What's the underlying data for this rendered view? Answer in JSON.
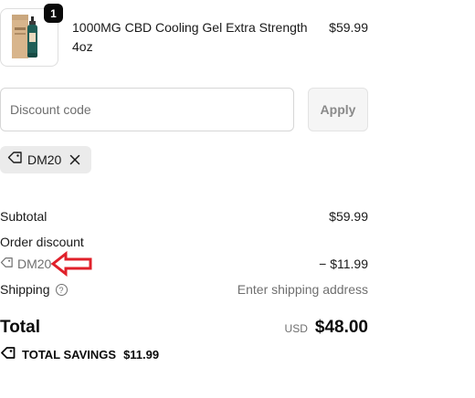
{
  "product": {
    "name": "1000MG CBD Cooling Gel Extra Strength 4oz",
    "price": "$59.99",
    "quantity": "1",
    "image_icon": "product-bottle-image"
  },
  "discount": {
    "placeholder": "Discount code",
    "value": "",
    "apply_label": "Apply",
    "applied_code": "DM20",
    "tag_icon": "tag-icon",
    "remove_icon": "close-icon"
  },
  "summary": {
    "subtotal_label": "Subtotal",
    "subtotal_value": "$59.99",
    "order_discount_label": "Order discount",
    "discount_code": "DM20",
    "discount_value": "− $11.99",
    "shipping_label": "Shipping",
    "shipping_value": "Enter shipping address",
    "total_label": "Total",
    "currency": "USD",
    "total_value": "$48.00",
    "savings_label": "TOTAL SAVINGS",
    "savings_value": "$11.99"
  },
  "colors": {
    "text": "#1a1a1a",
    "muted": "#6f6f6f",
    "chip_bg": "#ebebeb",
    "annotation": "#e0202a"
  }
}
